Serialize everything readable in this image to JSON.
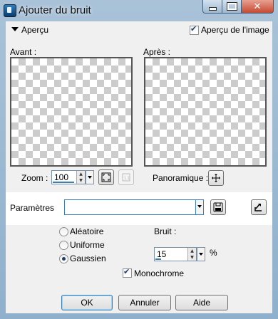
{
  "window": {
    "title": "Ajouter du bruit",
    "close_glyph": "✕"
  },
  "preview": {
    "section_label": "Aperçu",
    "show_preview_label": "Aperçu de l'image",
    "show_preview_checked": true,
    "before_label": "Avant :",
    "after_label": "Après :",
    "zoom_label": "Zoom :",
    "zoom_value": "100",
    "pan_label": "Panoramique :"
  },
  "presets": {
    "label": "Paramètres",
    "value": ""
  },
  "noise": {
    "options": [
      {
        "label": "Aléatoire",
        "selected": false
      },
      {
        "label": "Uniforme",
        "selected": false
      },
      {
        "label": "Gaussien",
        "selected": true
      }
    ],
    "amount_label": "Bruit :",
    "amount_value": "15",
    "unit": "%",
    "monochrome_label": "Monochrome",
    "monochrome_checked": true
  },
  "buttons": {
    "ok": "OK",
    "cancel": "Annuler",
    "help": "Aide"
  }
}
